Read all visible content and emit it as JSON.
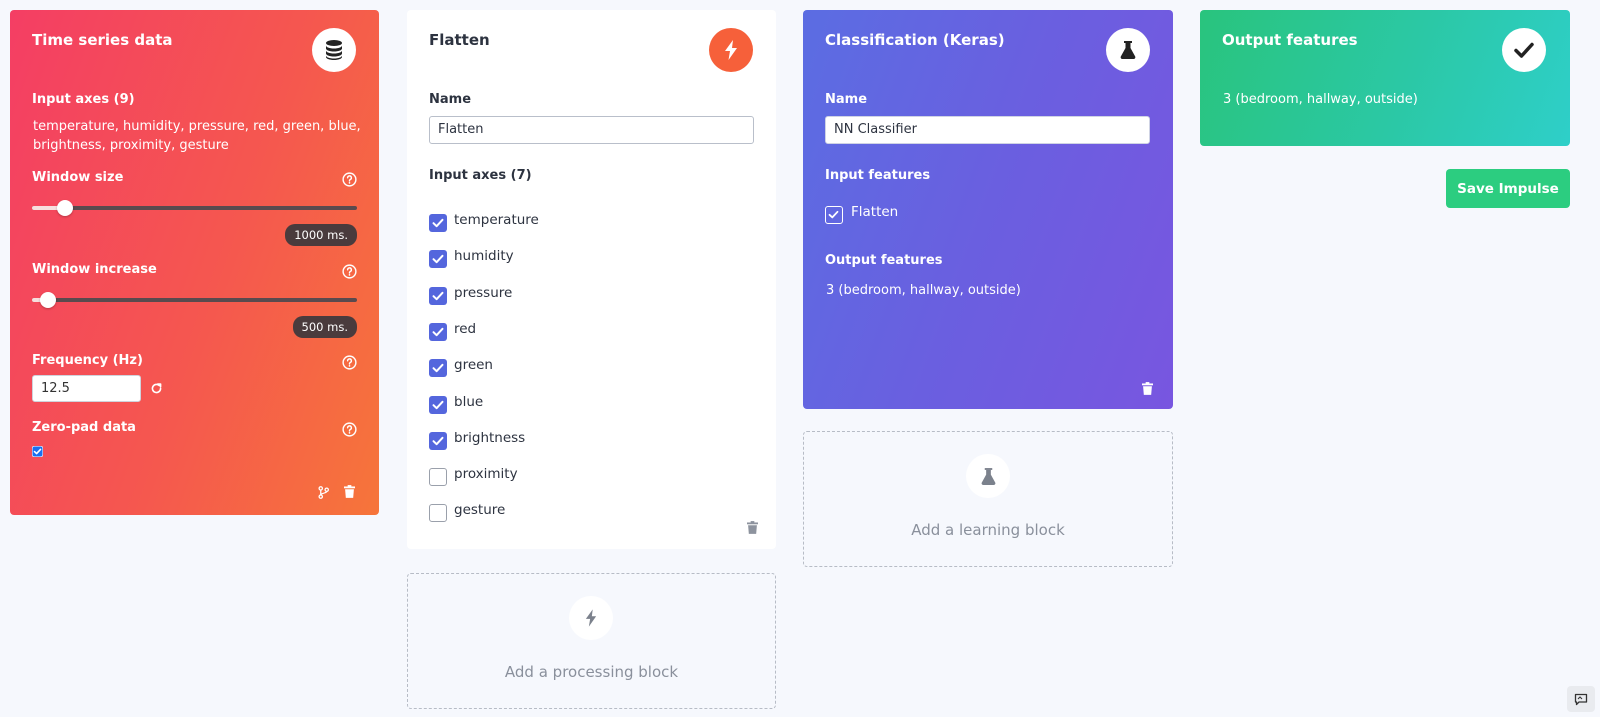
{
  "time_series": {
    "title": "Time series data",
    "input_axes_label": "Input axes (9)",
    "input_axes_line1": "temperature, humidity, pressure, red, green, blue,",
    "input_axes_line2": "brightness, proximity, gesture",
    "window_size_label": "Window size",
    "window_size_value": "1000 ms.",
    "window_size_fraction": 0.1,
    "window_increase_label": "Window increase",
    "window_increase_value": "500 ms.",
    "window_increase_fraction": 0.05,
    "frequency_label": "Frequency (Hz)",
    "frequency_value": "12.5",
    "zero_pad_label": "Zero-pad data",
    "zero_pad_checked": true,
    "icon": "database-icon"
  },
  "flatten": {
    "title": "Flatten",
    "name_label": "Name",
    "name_value": "Flatten",
    "input_axes_label": "Input axes (7)",
    "axes": [
      {
        "label": "temperature",
        "checked": true
      },
      {
        "label": "humidity",
        "checked": true
      },
      {
        "label": "pressure",
        "checked": true
      },
      {
        "label": "red",
        "checked": true
      },
      {
        "label": "green",
        "checked": true
      },
      {
        "label": "blue",
        "checked": true
      },
      {
        "label": "brightness",
        "checked": true
      },
      {
        "label": "proximity",
        "checked": false
      },
      {
        "label": "gesture",
        "checked": false
      }
    ],
    "icon": "lightning-icon"
  },
  "add_processing": {
    "label": "Add a processing block"
  },
  "classification": {
    "title": "Classification (Keras)",
    "name_label": "Name",
    "name_value": "NN Classifier",
    "input_features_label": "Input features",
    "input_feature": "Flatten",
    "output_features_label": "Output features",
    "output_features_value": "3 (bedroom, hallway, outside)",
    "icon": "flask-icon"
  },
  "add_learning": {
    "label": "Add a learning block"
  },
  "output": {
    "title": "Output features",
    "value": "3 (bedroom, hallway, outside)",
    "icon": "check-icon"
  },
  "save_button": {
    "label": "Save Impulse"
  },
  "colors": {
    "background": "#f6f8fd",
    "time_series_gradient_start": "#f43e64",
    "time_series_gradient_end": "#f6753a",
    "flatten_accent": "#f6603a",
    "classification_gradient_start": "#5b6de2",
    "classification_gradient_end": "#7856e0",
    "output_gradient_start": "#29c47d",
    "output_gradient_end": "#2ecfc9",
    "checkbox_checked": "#5466dd",
    "save_button": "#2ccd80"
  }
}
